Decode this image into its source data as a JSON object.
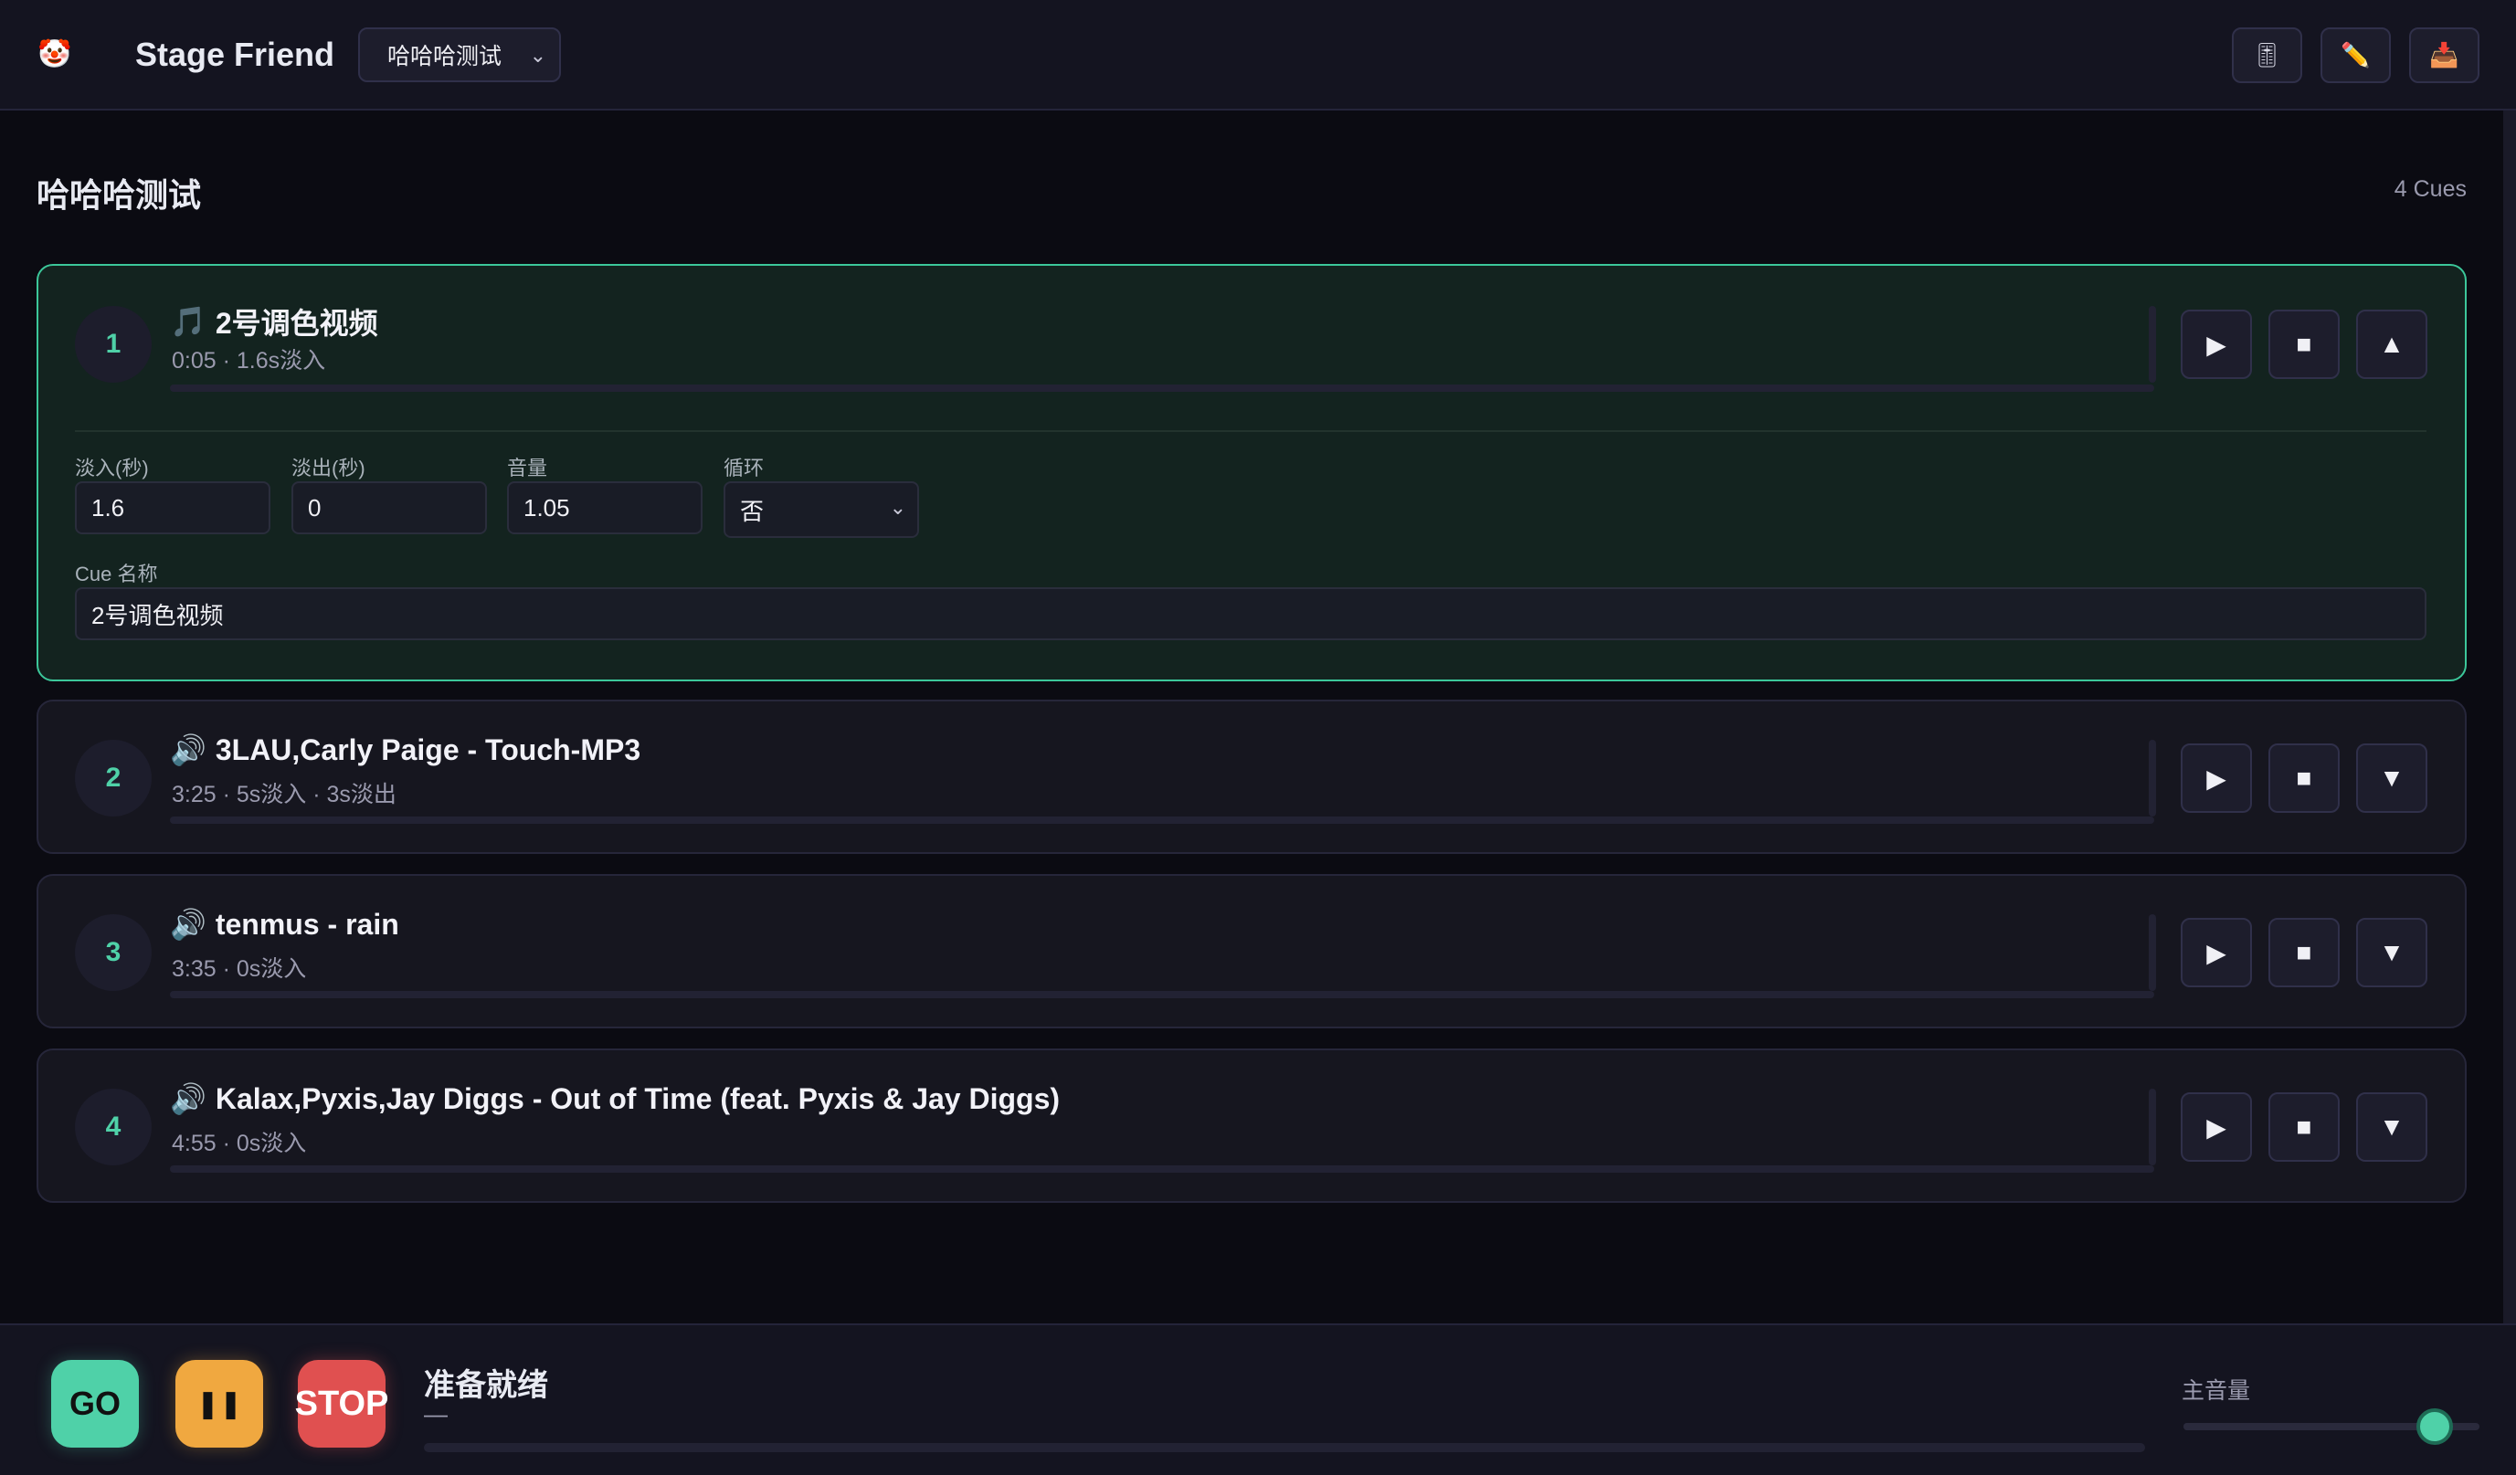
{
  "header": {
    "logo_icon": "clown-mascot-icon",
    "app_title": "Stage Friend",
    "project_select_value": "哈哈哈测试",
    "actions": [
      {
        "name": "mixer-button",
        "glyph": "🎚",
        "icon": "mixer-icon"
      },
      {
        "name": "edit-button",
        "glyph": "✏️",
        "icon": "pencil-icon"
      },
      {
        "name": "import-button",
        "glyph": "📥",
        "icon": "inbox-tray-icon"
      }
    ]
  },
  "main": {
    "title": "哈哈哈测试",
    "cue_count": "4 Cues"
  },
  "cues": [
    {
      "number": "1",
      "icon_glyph": "🎵",
      "title": "2号调色视频",
      "meta": "0:05 · 1.6s淡入",
      "progress": 0,
      "expand_glyph": "▲",
      "active": true,
      "editor": {
        "fade_in_label": "淡入(秒)",
        "fade_in_value": "1.6",
        "fade_out_label": "淡出(秒)",
        "fade_out_value": "0",
        "volume_label": "音量",
        "volume_value": "1.05",
        "loop_label": "循环",
        "loop_value": "否",
        "name_label": "Cue 名称",
        "name_value": "2号调色视频"
      }
    },
    {
      "number": "2",
      "icon_glyph": "🔊",
      "title": "3LAU,Carly Paige - Touch-MP3",
      "meta": "3:25 · 5s淡入 · 3s淡出",
      "progress": 0,
      "expand_glyph": "▼"
    },
    {
      "number": "3",
      "icon_glyph": "🔊",
      "title": "tenmus - rain",
      "meta": "3:35 · 0s淡入",
      "progress": 0,
      "expand_glyph": "▼"
    },
    {
      "number": "4",
      "icon_glyph": "🔊",
      "title": "Kalax,Pyxis,Jay Diggs - Out of Time (feat. Pyxis & Jay Diggs)",
      "meta": "4:55 · 0s淡入",
      "progress": 0,
      "expand_glyph": "▼"
    }
  ],
  "cue_controls": {
    "play_glyph": "▶",
    "stop_glyph": "■"
  },
  "footer": {
    "go_label": "GO",
    "pause_glyph": "❚❚",
    "stop_label": "STOP",
    "status_title": "准备就绪",
    "status_sub": "—",
    "status_progress": 0,
    "volume_label": "主音量",
    "master_volume": 0.85
  },
  "colors": {
    "accent": "#4fd1a8",
    "go": "#4fd1a8",
    "pause": "#f0a840",
    "stop": "#e05050",
    "background": "#0b0b12"
  }
}
